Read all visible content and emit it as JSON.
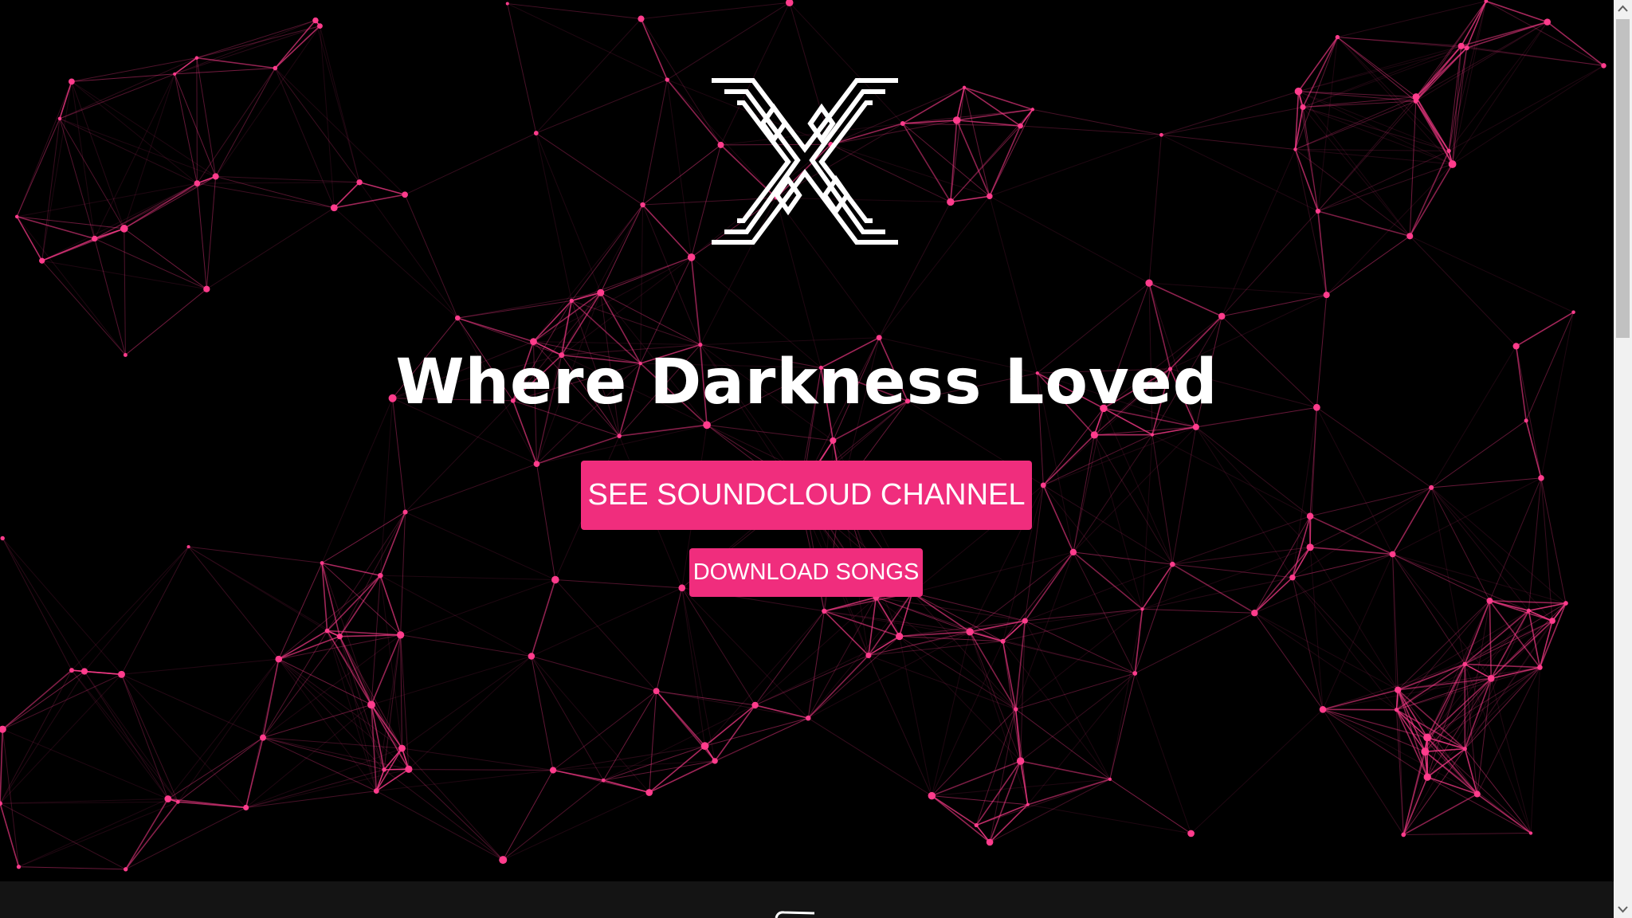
{
  "hero": {
    "tagline": "Where Darkness Loved",
    "logo": {
      "icon": "x-maze-logo",
      "color": "#ffffff"
    }
  },
  "buttons": {
    "soundcloud_label": "SEE SOUNDCLOUD CHANNEL",
    "download_label": "DOWNLOAD SONGS"
  },
  "colors": {
    "background": "#000000",
    "accent": "#f02d7d",
    "network_line": "#ff3c8c",
    "footer": "#141414"
  },
  "icons": {
    "footer": "partial-footer-icon",
    "scroll_up": "chevron-up-icon",
    "scroll_down": "chevron-down-icon"
  }
}
